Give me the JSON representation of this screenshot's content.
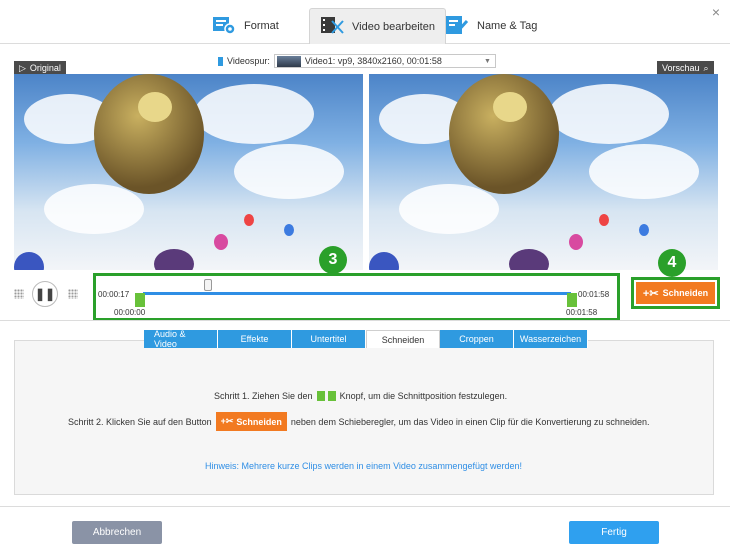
{
  "window": {
    "close_label": "×"
  },
  "tabs": [
    {
      "label": "Format",
      "icon": "format-icon"
    },
    {
      "label": "Video bearbeiten",
      "icon": "video-edit-icon"
    },
    {
      "label": "Name & Tag",
      "icon": "name-tag-icon"
    }
  ],
  "video": {
    "original_label": "Original",
    "preview_label": "Vorschau",
    "track_label": "Videospur:",
    "track_value": "Video1: vp9, 3840x2160, 00:01:58"
  },
  "timeline": {
    "current_time": "00:00:17",
    "end_time_top": "00:01:58",
    "start_time": "00:00:00",
    "end_time_bottom": "00:01:58"
  },
  "badges": {
    "three": "3",
    "four": "4"
  },
  "cut_button": {
    "label": "Schneiden"
  },
  "edit_tabs": [
    {
      "label": "Audio & Video",
      "active": false
    },
    {
      "label": "Effekte",
      "active": false
    },
    {
      "label": "Untertitel",
      "active": false
    },
    {
      "label": "Schneiden",
      "active": true
    },
    {
      "label": "Croppen",
      "active": false
    },
    {
      "label": "Wasserzeichen",
      "active": false
    }
  ],
  "instructions": {
    "step1_a": "Schritt 1. Ziehen Sie den",
    "step1_b": "Knopf, um die Schnittposition festzulegen.",
    "step2_a": "Schritt 2. Klicken Sie auf den Button",
    "step2_button": "Schneiden",
    "step2_b": "neben dem Schieberegler, um das Video in einen Clip für die Konvertierung zu schneiden.",
    "hint": "Hinweis: Mehrere kurze Clips werden in einem Video zusammengefügt werden!"
  },
  "footer": {
    "cancel_label": "Abbrechen",
    "done_label": "Fertig"
  },
  "colors": {
    "accent": "#2f9ae0",
    "cut_orange": "#f27a21",
    "highlight_green": "#2aa02a"
  }
}
